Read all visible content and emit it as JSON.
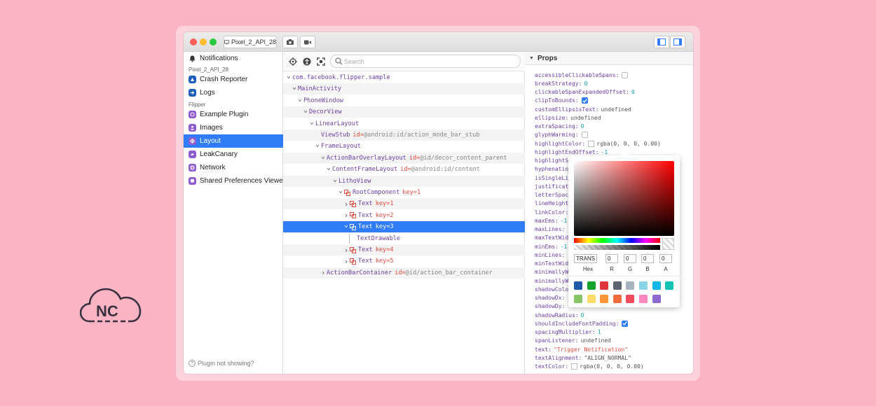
{
  "titlebar": {
    "device_label": "Pixel_2_API_28"
  },
  "sidebar": {
    "top_item": "Notifications",
    "device_section": "Pixel_2_API_28",
    "device_items": [
      "Crash Reporter",
      "Logs"
    ],
    "flipper_section": "Flipper",
    "flipper_items": [
      "Example Plugin",
      "Images",
      "Layout",
      "LeakCanary",
      "Network",
      "Shared Preferences Viewer"
    ],
    "selected": "Layout",
    "help_text": "Plugin not showing?"
  },
  "tree": {
    "search_placeholder": "Search",
    "rows": [
      {
        "label": "com.facebook.flipper.sample",
        "attr": "",
        "val": ""
      },
      {
        "label": "MainActivity",
        "attr": "",
        "val": ""
      },
      {
        "label": "PhoneWindow",
        "attr": "",
        "val": ""
      },
      {
        "label": "DecorView",
        "attr": "",
        "val": ""
      },
      {
        "label": "LinearLayout",
        "attr": "",
        "val": ""
      },
      {
        "label": "ViewStub",
        "attr": "id=",
        "val": "@android:id/action_mode_bar_stub"
      },
      {
        "label": "FrameLayout",
        "attr": "",
        "val": ""
      },
      {
        "label": "ActionBarOverlayLayout",
        "attr": "id=",
        "val": "@id/decor_content_parent"
      },
      {
        "label": "ContentFrameLayout",
        "attr": "id=",
        "val": "@android:id/content"
      },
      {
        "label": "LithoView",
        "attr": "",
        "val": ""
      },
      {
        "label": "RootComponent",
        "attr": "key=",
        "val": "1"
      },
      {
        "label": "Text",
        "attr": "key=",
        "val": "1"
      },
      {
        "label": "Text",
        "attr": "key=",
        "val": "2"
      },
      {
        "label": "Text",
        "attr": "key=",
        "val": "3"
      },
      {
        "label": "TextDrawable",
        "attr": "",
        "val": ""
      },
      {
        "label": "Text",
        "attr": "key=",
        "val": "4"
      },
      {
        "label": "Text",
        "attr": "key=",
        "val": "5"
      },
      {
        "label": "ActionBarContainer",
        "attr": "id=",
        "val": "@id/action_bar_container"
      }
    ]
  },
  "props": {
    "header": "Props",
    "items": [
      {
        "k": "accessibleClickableSpans:",
        "v": "",
        "t": "cb"
      },
      {
        "k": "breakStrategy:",
        "v": "0",
        "t": "num"
      },
      {
        "k": "clickableSpanExpandedOffset:",
        "v": "0",
        "t": "num"
      },
      {
        "k": "clipToBounds:",
        "v": "",
        "t": "cbc"
      },
      {
        "k": "customEllipsisText:",
        "v": "undefined",
        "t": "txt"
      },
      {
        "k": "ellipsize:",
        "v": "undefined",
        "t": "txt"
      },
      {
        "k": "extraSpacing:",
        "v": "0",
        "t": "num"
      },
      {
        "k": "glyphWarming:",
        "v": "",
        "t": "cb"
      },
      {
        "k": "highlightColor:",
        "v": "rgba(0, 0, 0, 0.00)",
        "t": "color"
      },
      {
        "k": "highlightEndOffset:",
        "v": "-1",
        "t": "num"
      },
      {
        "k": "highlightS",
        "v": "",
        "t": "txt"
      },
      {
        "k": "hyphenatio",
        "v": "",
        "t": "txt"
      },
      {
        "k": "isSingleLi",
        "v": "",
        "t": "txt"
      },
      {
        "k": "justificat",
        "v": "",
        "t": "txt"
      },
      {
        "k": "letterSpac",
        "v": "",
        "t": "txt"
      },
      {
        "k": "lineHeight",
        "v": "",
        "t": "txt"
      },
      {
        "k": "linkColor:",
        "v": "",
        "t": "txt"
      },
      {
        "k": "maxEms:",
        "v": "-1",
        "t": "num"
      },
      {
        "k": "maxLines:",
        "v": "",
        "t": "txt"
      },
      {
        "k": "maxTextWid",
        "v": "",
        "t": "txt"
      },
      {
        "k": "minEms:",
        "v": "-1",
        "t": "num"
      },
      {
        "k": "minLines:",
        "v": "",
        "t": "txt"
      },
      {
        "k": "minTextWid",
        "v": "",
        "t": "txt"
      },
      {
        "k": "minimallyW",
        "v": "",
        "t": "txt"
      },
      {
        "k": "minimallyW",
        "v": "",
        "t": "txt"
      },
      {
        "k": "shadowColo",
        "v": "",
        "t": "txt"
      },
      {
        "k": "shadowDx:",
        "v": "",
        "t": "txt"
      },
      {
        "k": "shadowDy:",
        "v": "",
        "t": "txt"
      },
      {
        "k": "shadowRadius:",
        "v": "0",
        "t": "num"
      },
      {
        "k": "shouldIncludeFontPadding:",
        "v": "",
        "t": "cbc"
      },
      {
        "k": "spacingMultiplier:",
        "v": "1",
        "t": "num"
      },
      {
        "k": "spanListener:",
        "v": "undefined",
        "t": "txt"
      },
      {
        "k": "text:",
        "v": "\"Trigger Notification\"",
        "t": "str"
      },
      {
        "k": "textAlignment:",
        "v": "\"ALIGN_NORMAL\"",
        "t": "txt"
      },
      {
        "k": "textColor:",
        "v": "rgba(0, 0, 0, 0.00)",
        "t": "color"
      }
    ]
  },
  "picker": {
    "hex_value": "TRANS",
    "r_value": "0",
    "g_value": "0",
    "b_value": "0",
    "a_value": "0",
    "labels": [
      "Hex",
      "R",
      "G",
      "B",
      "A"
    ],
    "swatches": [
      "#1f5aa8",
      "#12a32f",
      "#e0343f",
      "#5a6370",
      "#a6b3be",
      "#8bd3e6",
      "#11b7e4",
      "#13c3b5",
      "#86c665",
      "#fddc6b",
      "#fb9337",
      "#f06b3b",
      "#f04b5d",
      "#fb87bf",
      "#8e6ad0"
    ]
  },
  "colors": {
    "background": "#fbb4c3",
    "accent": "#2f7cf6"
  }
}
